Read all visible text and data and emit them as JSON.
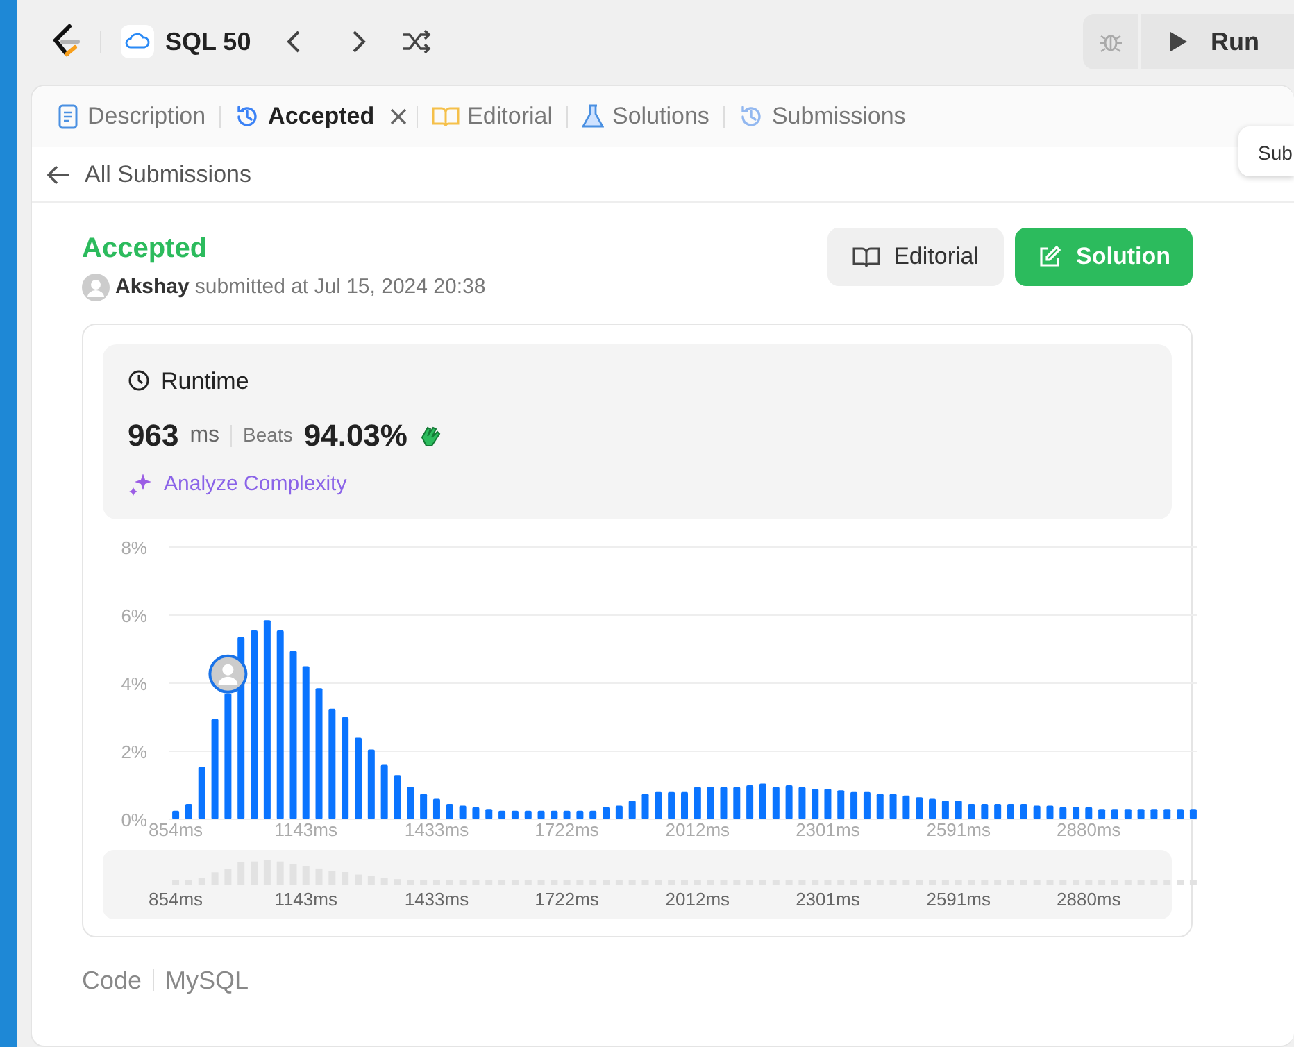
{
  "topbar": {
    "problem_list": "SQL 50",
    "run": "Run"
  },
  "tooltip": "Sub",
  "tabs": [
    {
      "label": "Description",
      "selected": false,
      "closable": false
    },
    {
      "label": "Accepted",
      "selected": true,
      "closable": true
    },
    {
      "label": "Editorial",
      "selected": false,
      "closable": false
    },
    {
      "label": "Solutions",
      "selected": false,
      "closable": false
    },
    {
      "label": "Submissions",
      "selected": false,
      "closable": false
    }
  ],
  "back_link": "All Submissions",
  "submission": {
    "status": "Accepted",
    "user": "Akshay",
    "submitted": "submitted at Jul 15, 2024 20:38",
    "editorial_button": "Editorial",
    "solution_button": "Solution"
  },
  "runtime": {
    "title": "Runtime",
    "value": "963",
    "unit": "ms",
    "beats_label": "Beats",
    "beats": "94.03%",
    "analyze": "Analyze Complexity",
    "chart_data": {
      "type": "bar",
      "grid": true,
      "ylim": [
        0,
        8
      ],
      "xlim": [
        840,
        3126
      ],
      "yticks": [
        {
          "value": 0,
          "label": "0%"
        },
        {
          "value": 2,
          "label": "2%"
        },
        {
          "value": 4,
          "label": "4%"
        },
        {
          "value": 6,
          "label": "6%"
        },
        {
          "value": 8,
          "label": "8%"
        }
      ],
      "xticks": [
        {
          "value": 854,
          "label": "854ms"
        },
        {
          "value": 1143,
          "label": "1143ms"
        },
        {
          "value": 1433,
          "label": "1433ms"
        },
        {
          "value": 1722,
          "label": "1722ms"
        },
        {
          "value": 2012,
          "label": "2012ms"
        },
        {
          "value": 2301,
          "label": "2301ms"
        },
        {
          "value": 2591,
          "label": "2591ms"
        },
        {
          "value": 2880,
          "label": "2880ms"
        }
      ],
      "x": [
        854,
        883,
        912,
        941,
        970,
        999,
        1028,
        1057,
        1086,
        1115,
        1143,
        1172,
        1201,
        1230,
        1259,
        1288,
        1317,
        1346,
        1375,
        1404,
        1433,
        1462,
        1491,
        1520,
        1549,
        1578,
        1607,
        1636,
        1665,
        1694,
        1722,
        1751,
        1780,
        1809,
        1838,
        1867,
        1896,
        1925,
        1954,
        1983,
        2012,
        2041,
        2070,
        2099,
        2128,
        2157,
        2186,
        2215,
        2244,
        2273,
        2301,
        2330,
        2359,
        2388,
        2417,
        2446,
        2475,
        2504,
        2533,
        2562,
        2591,
        2620,
        2649,
        2678,
        2707,
        2736,
        2765,
        2794,
        2823,
        2852,
        2880,
        2909,
        2938,
        2967,
        2996,
        3025,
        3054,
        3083,
        3112
      ],
      "values": [
        0.25,
        0.45,
        1.55,
        2.95,
        3.7,
        5.35,
        5.55,
        5.85,
        5.55,
        4.95,
        4.5,
        3.85,
        3.25,
        3.0,
        2.4,
        2.05,
        1.6,
        1.3,
        0.95,
        0.75,
        0.6,
        0.45,
        0.4,
        0.35,
        0.3,
        0.25,
        0.25,
        0.25,
        0.25,
        0.25,
        0.25,
        0.25,
        0.25,
        0.35,
        0.4,
        0.55,
        0.75,
        0.8,
        0.8,
        0.8,
        0.95,
        0.95,
        0.95,
        0.95,
        1.0,
        1.05,
        0.95,
        1.0,
        0.95,
        0.9,
        0.9,
        0.85,
        0.8,
        0.8,
        0.75,
        0.75,
        0.7,
        0.65,
        0.6,
        0.55,
        0.55,
        0.45,
        0.45,
        0.45,
        0.45,
        0.45,
        0.4,
        0.4,
        0.35,
        0.35,
        0.35,
        0.3,
        0.3,
        0.3,
        0.3,
        0.3,
        0.3,
        0.3,
        0.3
      ]
    },
    "brush_labels": [
      "854ms",
      "1143ms",
      "1433ms",
      "1722ms",
      "2012ms",
      "2301ms",
      "2591ms",
      "2880ms"
    ]
  },
  "code": {
    "label": "Code",
    "language": "MySQL"
  }
}
